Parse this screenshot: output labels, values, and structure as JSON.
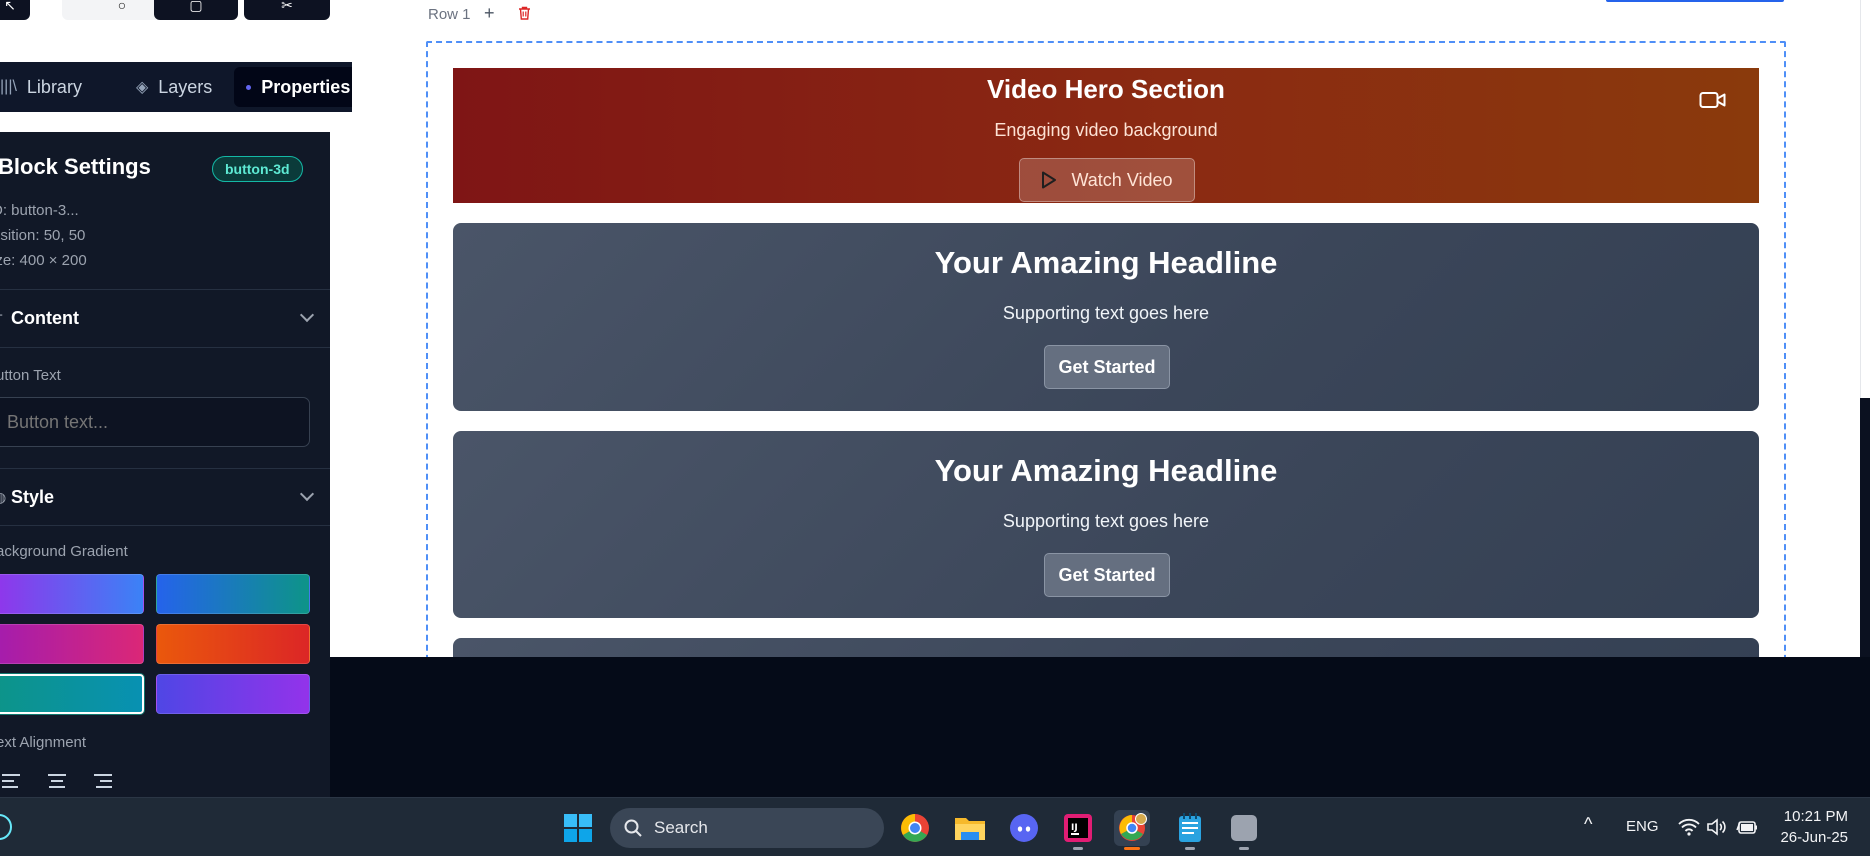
{
  "sidebar": {
    "tabs": [
      {
        "label": "Library",
        "icon": "library-icon"
      },
      {
        "label": "Layers",
        "icon": "layers-icon"
      },
      {
        "label": "Properties",
        "icon": "properties-dot-icon"
      }
    ],
    "block_settings": {
      "title": "Block Settings",
      "badge": "button-3d",
      "id_text": "D: button-3...",
      "position_text": "osition: 50, 50",
      "size_text": "ize: 400 × 200"
    },
    "content_section": {
      "title": "Content",
      "button_text_label": "utton Text",
      "button_text_placeholder": "Button text..."
    },
    "style_section": {
      "title": "Style",
      "bg_gradient_label": "ackground Gradient",
      "swatches": [
        {
          "from": "#9333ea",
          "to": "#3b82f6"
        },
        {
          "from": "#2563eb",
          "to": "#0d9488"
        },
        {
          "from": "#a21caf",
          "to": "#db2777"
        },
        {
          "from": "#ea580c",
          "to": "#dc2626"
        },
        {
          "from": "#0d9488",
          "to": "#0891b2",
          "selected": true
        },
        {
          "from": "#4f46e5",
          "to": "#9333ea"
        }
      ],
      "text_alignment_label": "ext Alignment"
    }
  },
  "canvas": {
    "row_label": "Row 1",
    "hero": {
      "title": "Video Hero Section",
      "subtitle": "Engaging video background",
      "button": "Watch Video"
    },
    "cards": [
      {
        "title": "Your Amazing Headline",
        "subtitle": "Supporting text goes here",
        "button": "Get Started"
      },
      {
        "title": "Your Amazing Headline",
        "subtitle": "Supporting text goes here",
        "button": "Get Started"
      }
    ]
  },
  "taskbar": {
    "search_placeholder": "Search",
    "language": "ENG",
    "time": "10:21 PM",
    "date": "26-Jun-25",
    "apps": [
      "windows-start-icon",
      "chrome-icon",
      "file-explorer-icon",
      "discord-icon",
      "intellij-icon",
      "chrome-profile-icon",
      "notepad-icon",
      "generic-app-icon"
    ]
  }
}
